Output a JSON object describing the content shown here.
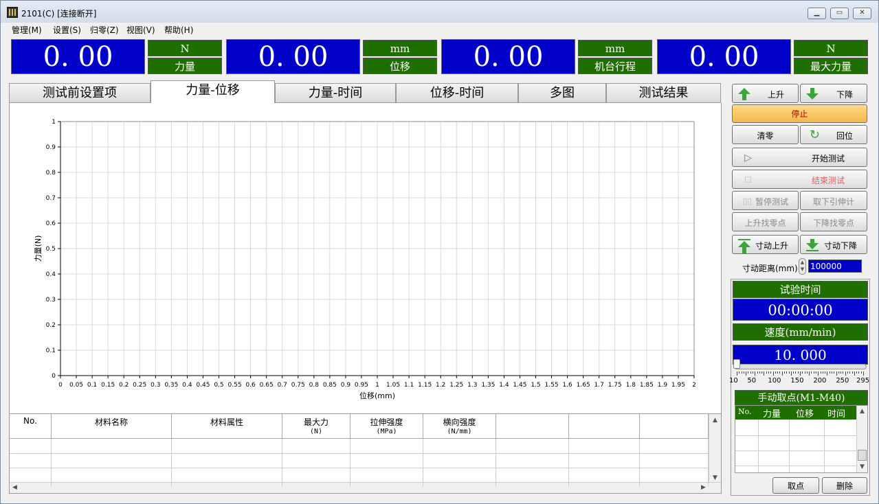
{
  "window": {
    "title": "2101(C)   [连接断开]"
  },
  "menu": [
    "管理(M)",
    "设置(S)",
    "归零(Z)",
    "视图(V)",
    "帮助(H)"
  ],
  "readouts": [
    {
      "value": "0. 00",
      "unit": "N",
      "name": "力量"
    },
    {
      "value": "0. 00",
      "unit": "mm",
      "name": "位移"
    },
    {
      "value": "0. 00",
      "unit": "mm",
      "name": "机台行程"
    },
    {
      "value": "0. 00",
      "unit": "N",
      "name": "最大力量"
    }
  ],
  "tabs": [
    {
      "label": "测试前设置项"
    },
    {
      "label": "力量-位移"
    },
    {
      "label": "力量-时间"
    },
    {
      "label": "位移-时间"
    },
    {
      "label": "多图"
    },
    {
      "label": "测试结果"
    }
  ],
  "chart_data": {
    "type": "line",
    "xlabel": "位移(mm)",
    "ylabel": "力量(N)",
    "xlim": [
      0,
      2
    ],
    "ylim": [
      0,
      1
    ],
    "x_ticks": [
      "0",
      "0.05",
      "0.1",
      "0.15",
      "0.2",
      "0.25",
      "0.3",
      "0.35",
      "0.4",
      "0.45",
      "0.5",
      "0.55",
      "0.6",
      "0.65",
      "0.7",
      "0.75",
      "0.8",
      "0.85",
      "0.9",
      "0.95",
      "1",
      "1.05",
      "1.1",
      "1.15",
      "1.2",
      "1.25",
      "1.3",
      "1.35",
      "1.4",
      "1.45",
      "1.5",
      "1.55",
      "1.6",
      "1.65",
      "1.7",
      "1.75",
      "1.8",
      "1.85",
      "1.9",
      "1.95",
      "2"
    ],
    "y_ticks": [
      "0",
      "0.1",
      "0.2",
      "0.3",
      "0.4",
      "0.5",
      "0.6",
      "0.7",
      "0.8",
      "0.9",
      "1"
    ],
    "grid": true,
    "series": []
  },
  "table": {
    "headers": [
      {
        "label": "No.",
        "sub": ""
      },
      {
        "label": "材料名称",
        "sub": ""
      },
      {
        "label": "材料属性",
        "sub": ""
      },
      {
        "label": "最大力",
        "sub": "(N)"
      },
      {
        "label": "拉伸强度",
        "sub": "(MPa)"
      },
      {
        "label": "横向强度",
        "sub": "(N/mm)"
      },
      {
        "label": "",
        "sub": ""
      },
      {
        "label": "",
        "sub": ""
      },
      {
        "label": "",
        "sub": ""
      }
    ]
  },
  "controls": {
    "up": "上升",
    "down": "下降",
    "stop": "停止",
    "zero": "清零",
    "return": "回位",
    "start": "开始测试",
    "end": "结束测试",
    "pause": "暂停测试",
    "remove_ext": "取下引伸计",
    "up_find_zero": "上升找零点",
    "down_find_zero": "下降找零点",
    "jog_up": "寸动上升",
    "jog_down": "寸动下降",
    "jog_distance_label": "寸动距离(mm)",
    "jog_distance_value": "100000"
  },
  "test_time": {
    "label": "试验时间",
    "value": "00:00:00"
  },
  "speed": {
    "label": "速度(mm/min)",
    "value": "10. 000",
    "scale": [
      "10",
      "50",
      "100",
      "150",
      "200",
      "250",
      "295"
    ],
    "level": 10
  },
  "manual_points": {
    "title": "手动取点(M1-M40)",
    "headers": [
      "No.",
      "力量",
      "位移",
      "时间"
    ],
    "take": "取点",
    "delete": "删除"
  },
  "colors": {
    "display_blue": "#0000c8",
    "label_green": "#1f6e00",
    "stop_orange": "#f5b84a"
  }
}
